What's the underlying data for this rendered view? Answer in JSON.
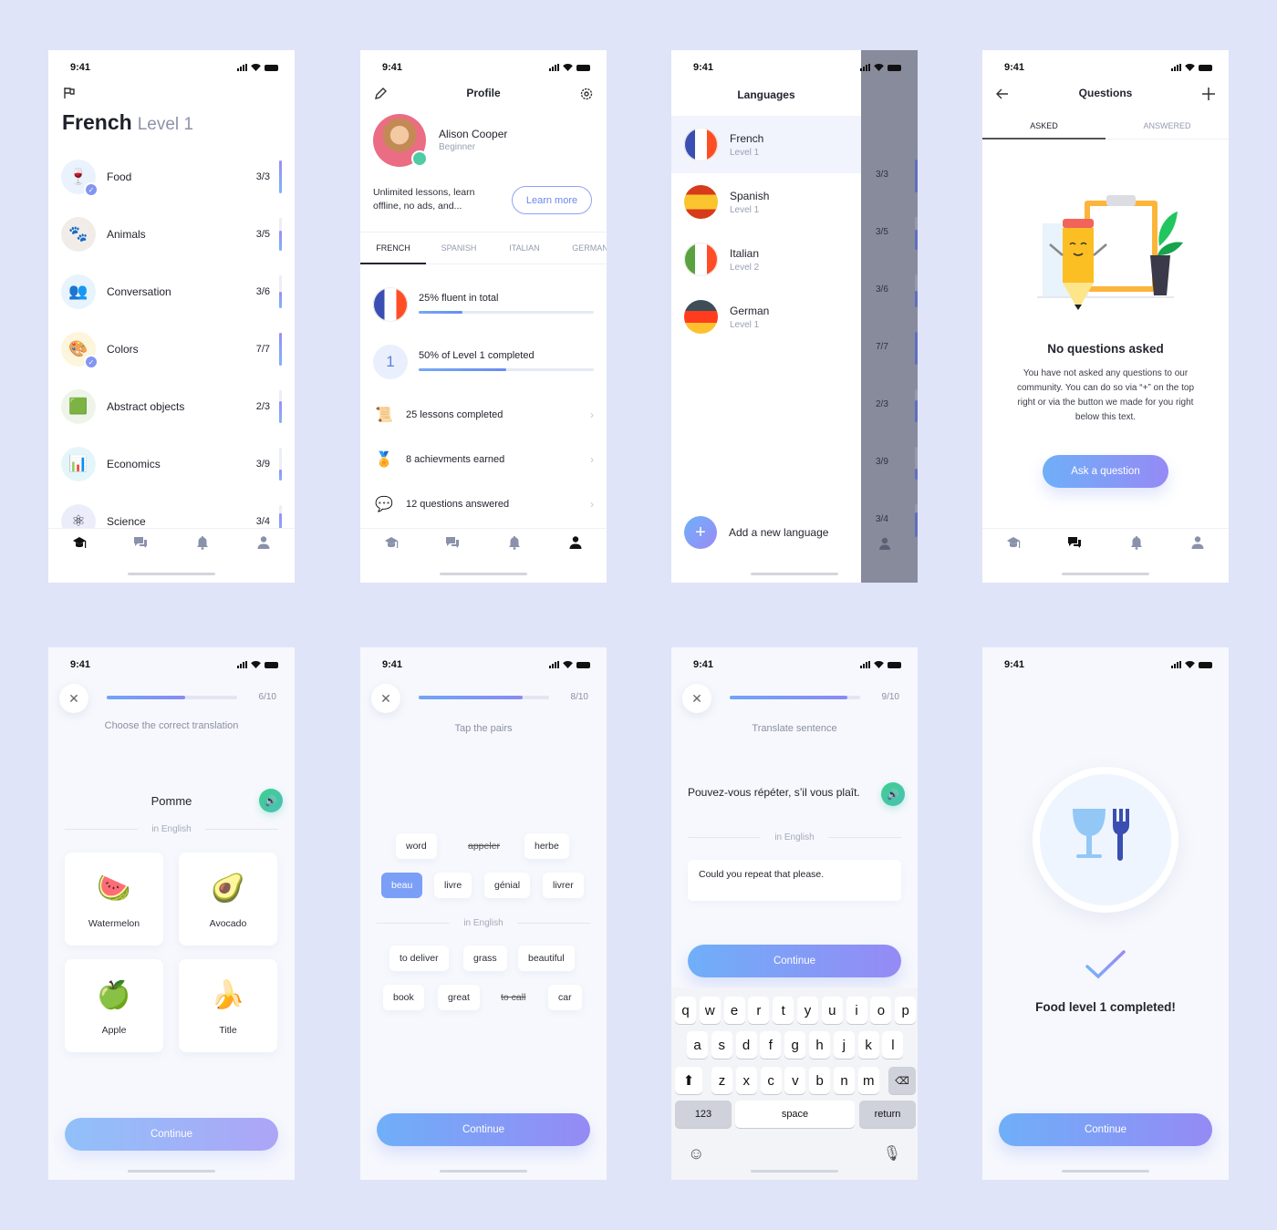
{
  "status_time": "9:41",
  "tabbar": {
    "items": [
      {
        "name": "courses",
        "icon": "graduation-cap-icon"
      },
      {
        "name": "questions",
        "icon": "chat-icon"
      },
      {
        "name": "notifications",
        "icon": "bell-icon"
      },
      {
        "name": "profile",
        "icon": "person-icon"
      }
    ]
  },
  "screen_course": {
    "title": "French",
    "level": "Level 1",
    "topics": [
      {
        "label": "Food",
        "count": "3/3",
        "progress": 1.0,
        "icon": "🍷",
        "bg": "#eaf2fd",
        "completed": true
      },
      {
        "label": "Animals",
        "count": "3/5",
        "progress": 0.6,
        "icon": "🐾",
        "bg": "#f1ece8",
        "completed": false
      },
      {
        "label": "Conversation",
        "count": "3/6",
        "progress": 0.5,
        "icon": "👥",
        "bg": "#e7f3fd",
        "completed": false
      },
      {
        "label": "Colors",
        "count": "7/7",
        "progress": 1.0,
        "icon": "🎨",
        "bg": "#fdf5dc",
        "completed": true
      },
      {
        "label": "Abstract objects",
        "count": "2/3",
        "progress": 0.67,
        "icon": "🟩",
        "bg": "#eef5e8",
        "completed": false
      },
      {
        "label": "Economics",
        "count": "3/9",
        "progress": 0.33,
        "icon": "📊",
        "bg": "#e5f6fb",
        "completed": false
      },
      {
        "label": "Science",
        "count": "3/4",
        "progress": 0.75,
        "icon": "⚛",
        "bg": "#ecedfb",
        "completed": false
      }
    ],
    "active_tab": 0
  },
  "screen_profile": {
    "title": "Profile",
    "name": "Alison Cooper",
    "level": "Beginner",
    "promo": "Unlimited lessons, learn offline, no ads, and...",
    "learn_more": "Learn more",
    "tabs": [
      "FRENCH",
      "SPANISH",
      "ITALIAN",
      "GERMAN"
    ],
    "active_language_tab": 0,
    "stats": [
      {
        "label": "25% fluent in total",
        "progress": 0.25
      },
      {
        "label": "50% of Level 1 completed",
        "progress": 0.5,
        "badge": "1"
      }
    ],
    "rows": [
      {
        "label": "25 lessons completed",
        "icon": "📜"
      },
      {
        "label": "8 achievments earned",
        "icon": "🏅"
      },
      {
        "label": "12 questions answered",
        "icon": "💬"
      }
    ],
    "active_tab": 3
  },
  "screen_languages": {
    "title": "Languages",
    "languages": [
      {
        "name": "French",
        "level": "Level 1",
        "selected": true
      },
      {
        "name": "Spanish",
        "level": "Level 1",
        "selected": false
      },
      {
        "name": "Italian",
        "level": "Level 2",
        "selected": false
      },
      {
        "name": "German",
        "level": "Level 1",
        "selected": false
      }
    ],
    "add_label": "Add a new language",
    "overlay_counts": [
      {
        "count": "3/3",
        "progress": 1.0
      },
      {
        "count": "3/5",
        "progress": 0.6
      },
      {
        "count": "3/6",
        "progress": 0.5
      },
      {
        "count": "7/7",
        "progress": 1.0
      },
      {
        "count": "2/3",
        "progress": 0.67
      },
      {
        "count": "3/9",
        "progress": 0.33
      },
      {
        "count": "3/4",
        "progress": 0.75
      }
    ]
  },
  "screen_questions": {
    "title": "Questions",
    "tabs": [
      "ASKED",
      "ANSWERED"
    ],
    "active_question_tab": 0,
    "empty_title": "No questions asked",
    "empty_body": "You have not asked any questions to our community. You can do so via “+” on the top right or via the button we made for you right below this text.",
    "cta": "Ask a question",
    "active_tab": 1
  },
  "screen_choose": {
    "progress_label": "6/10",
    "progress": 0.6,
    "prompt": "Choose the correct translation",
    "word": "Pomme",
    "divider": "in English",
    "options": [
      {
        "label": "Watermelon",
        "icon": "🍉"
      },
      {
        "label": "Avocado",
        "icon": "🥑"
      },
      {
        "label": "Apple",
        "icon": "🍏"
      },
      {
        "label": "Title",
        "icon": "🍌"
      }
    ],
    "continue": "Continue"
  },
  "screen_pairs": {
    "progress_label": "8/10",
    "progress": 0.8,
    "prompt": "Tap the pairs",
    "french_row1": [
      {
        "word": "word",
        "state": "normal"
      },
      {
        "word": "appeler",
        "state": "done"
      },
      {
        "word": "herbe",
        "state": "normal"
      }
    ],
    "french_row2": [
      {
        "word": "beau",
        "state": "selected"
      },
      {
        "word": "livre",
        "state": "normal"
      },
      {
        "word": "génial",
        "state": "normal"
      },
      {
        "word": "livrer",
        "state": "normal"
      }
    ],
    "divider": "in English",
    "english_row1": [
      {
        "word": "to deliver",
        "state": "normal"
      },
      {
        "word": "grass",
        "state": "normal"
      },
      {
        "word": "beautiful",
        "state": "normal"
      }
    ],
    "english_row2": [
      {
        "word": "book",
        "state": "normal"
      },
      {
        "word": "great",
        "state": "normal"
      },
      {
        "word": "to call",
        "state": "done"
      },
      {
        "word": "car",
        "state": "normal"
      }
    ],
    "continue": "Continue"
  },
  "screen_translate": {
    "progress_label": "9/10",
    "progress": 0.9,
    "prompt": "Translate sentence",
    "sentence": "Pouvez-vous répéter, s’il vous plaît.",
    "divider": "in English",
    "answer": "Could you repeat that please.",
    "continue": "Continue",
    "keyboard": {
      "row1": [
        "q",
        "w",
        "e",
        "r",
        "t",
        "y",
        "u",
        "i",
        "o",
        "p"
      ],
      "row2": [
        "a",
        "s",
        "d",
        "f",
        "g",
        "h",
        "j",
        "k",
        "l"
      ],
      "row3": [
        "z",
        "x",
        "c",
        "v",
        "b",
        "n",
        "m"
      ],
      "numbers": "123",
      "space": "space",
      "return": "return"
    }
  },
  "screen_done": {
    "title": "Food level 1 completed!",
    "continue": "Continue"
  }
}
